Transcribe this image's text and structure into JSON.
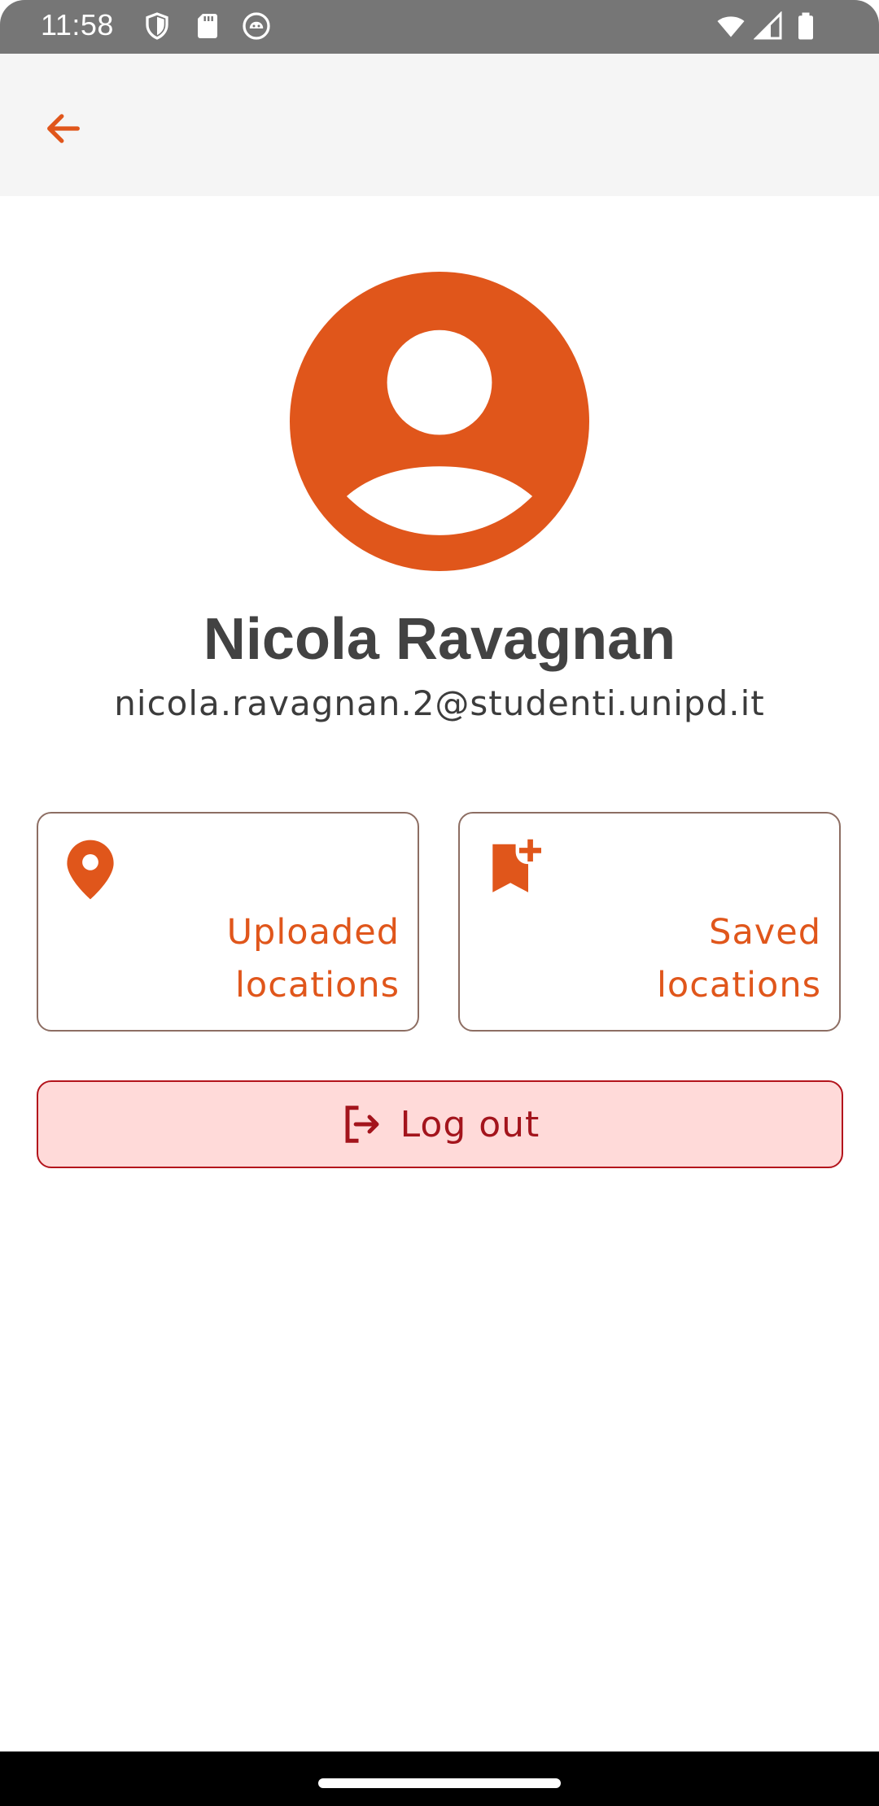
{
  "status_bar": {
    "time": "11:58",
    "left_icons": [
      "shield-icon",
      "sd-card-icon",
      "android-debug-icon"
    ],
    "right_icons": [
      "wifi-icon",
      "cell-signal-icon",
      "battery-icon"
    ]
  },
  "app_bar": {
    "back_icon": "arrow-back-icon"
  },
  "profile": {
    "avatar_icon": "account-circle-icon",
    "name": "Nicola Ravagnan",
    "email": "nicola.ravagnan.2@studenti.unipd.it"
  },
  "cards": {
    "uploaded": {
      "icon": "location-pin-icon",
      "label_line1": "Uploaded",
      "label_line2": "locations"
    },
    "saved": {
      "icon": "bookmark-add-icon",
      "label_line1": "Saved",
      "label_line2": "locations"
    }
  },
  "logout": {
    "icon": "logout-icon",
    "label": "Log out"
  },
  "colors": {
    "accent": "#e0561b",
    "logout_bg": "#ffdad9",
    "logout_fg": "#a3141c",
    "card_border": "#8d6e63",
    "status_bar": "#767676",
    "app_bar": "#f5f5f5"
  }
}
